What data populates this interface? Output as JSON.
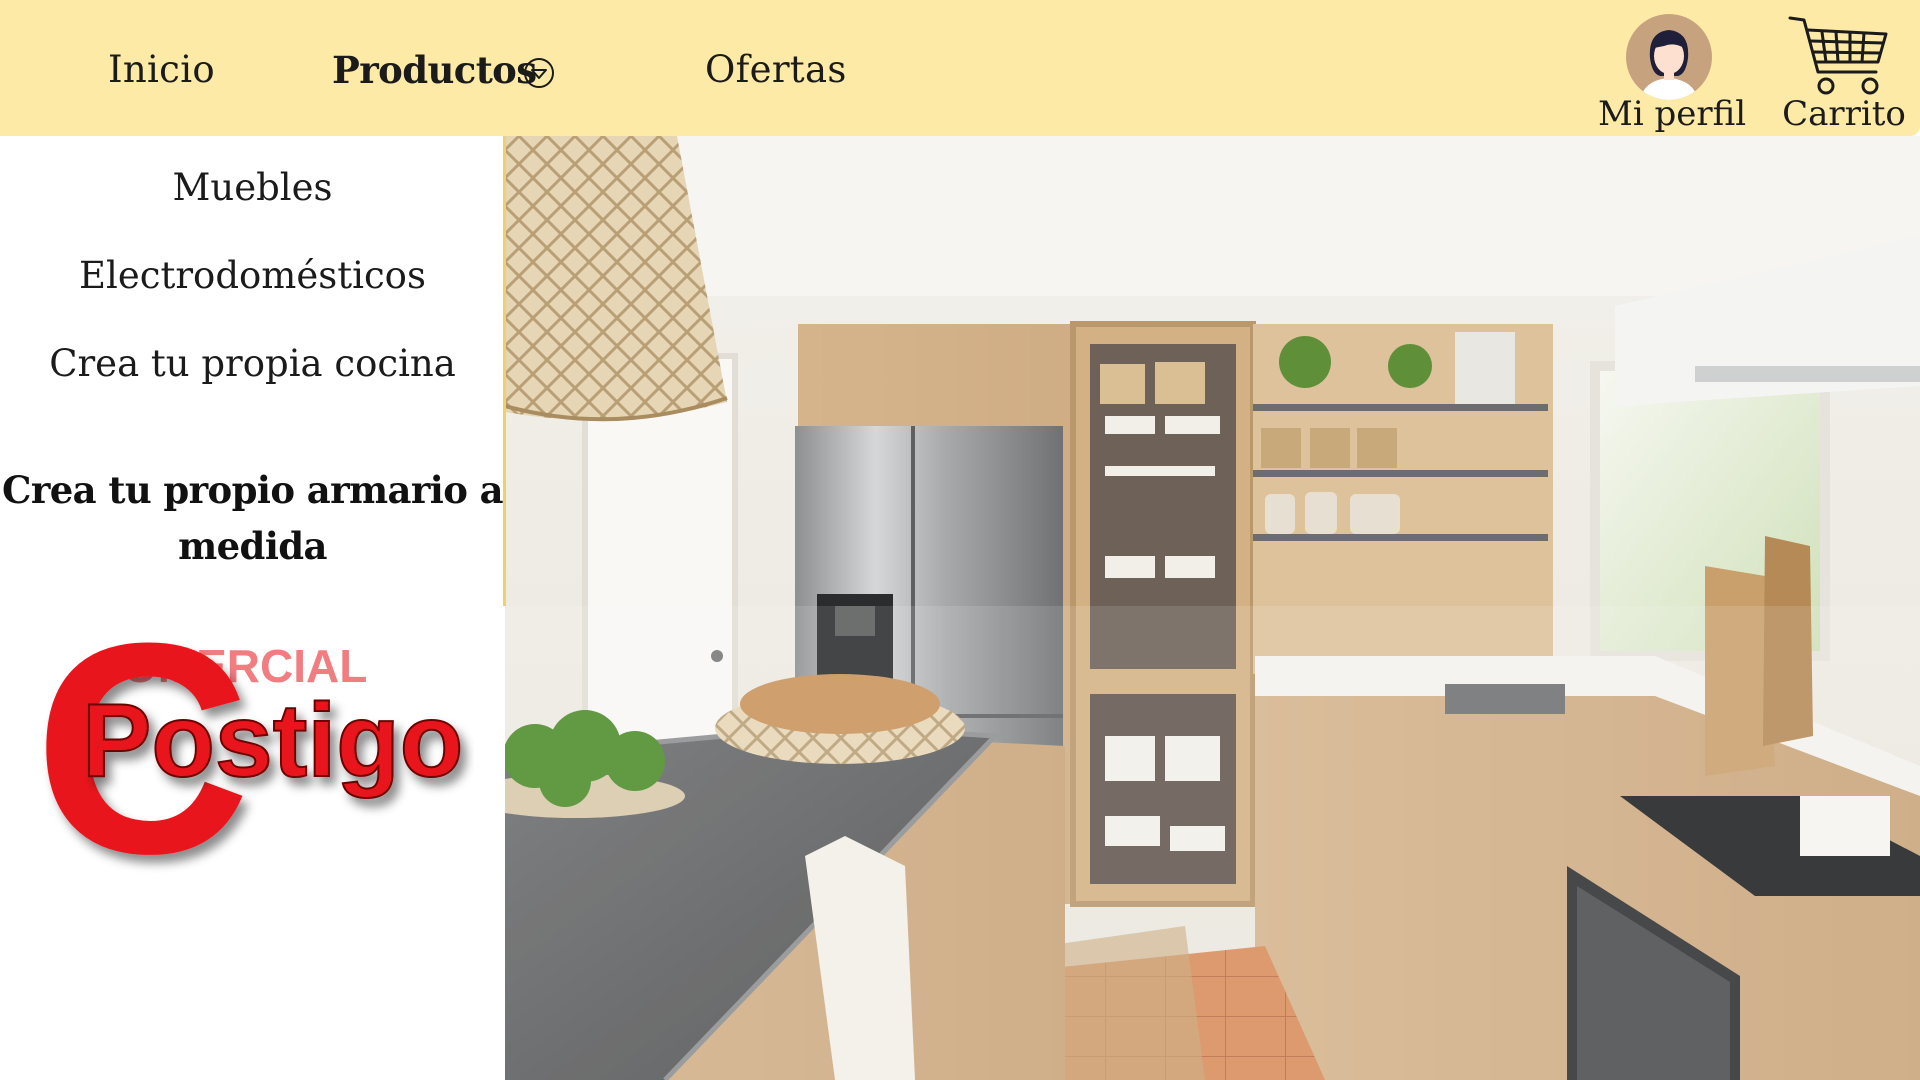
{
  "nav": {
    "inicio": "Inicio",
    "productos": "Productos",
    "ofertas": "Ofertas"
  },
  "utility": {
    "profile_label": "Mi perfil",
    "cart_label": "Carrito"
  },
  "dropdown": {
    "items": [
      "Muebles",
      "Electrodomésticos",
      "Crea tu propia cocina",
      "Crea tu propio armario a medida"
    ]
  },
  "logo": {
    "text": "Postigo",
    "letter": "C",
    "ghost_text": "OMERCIAL"
  },
  "colors": {
    "topbar": "#fdeaa6",
    "logo_red": "#e8141c",
    "dropdown_accent": "#f1d066"
  },
  "icons": [
    "chevron-down-circle-icon",
    "avatar-icon",
    "shopping-cart-icon"
  ]
}
